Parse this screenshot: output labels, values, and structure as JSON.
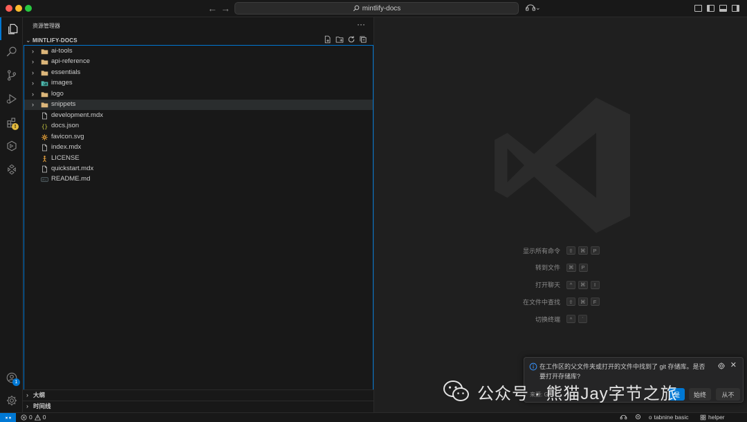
{
  "window": {
    "command_center": "mintlify-docs"
  },
  "activity_bar": {
    "accounts_badge": "1"
  },
  "explorer": {
    "title": "资源管理器",
    "more": "···",
    "folder_name": "MINTLIFY-DOCS",
    "items": [
      {
        "label": "ai-tools",
        "type": "folder"
      },
      {
        "label": "api-reference",
        "type": "folder"
      },
      {
        "label": "essentials",
        "type": "folder"
      },
      {
        "label": "images",
        "type": "folder-images"
      },
      {
        "label": "logo",
        "type": "folder"
      },
      {
        "label": "snippets",
        "type": "folder"
      },
      {
        "label": "development.mdx",
        "type": "file"
      },
      {
        "label": "docs.json",
        "type": "json"
      },
      {
        "label": "favicon.svg",
        "type": "svg"
      },
      {
        "label": "index.mdx",
        "type": "file"
      },
      {
        "label": "LICENSE",
        "type": "license"
      },
      {
        "label": "quickstart.mdx",
        "type": "file"
      },
      {
        "label": "README.md",
        "type": "markdown"
      }
    ],
    "selected_index": 5,
    "outline_label": "大纲",
    "timeline_label": "时间线"
  },
  "editor": {
    "shortcuts": [
      {
        "label": "显示所有命令",
        "keys": [
          "⇧",
          "⌘",
          "P"
        ]
      },
      {
        "label": "转到文件",
        "keys": [
          "⌘",
          "P"
        ]
      },
      {
        "label": "打开聊天",
        "keys": [
          "^",
          "⌘",
          "I"
        ]
      },
      {
        "label": "在文件中查找",
        "keys": [
          "⇧",
          "⌘",
          "F"
        ]
      },
      {
        "label": "切换终端",
        "keys": [
          "^",
          "`"
        ]
      }
    ]
  },
  "notification": {
    "message": "在工作区的父文件夹或打开的文件中找到了 git 存储库。是否要打开存储库?",
    "source": "来源: Git",
    "buttons": {
      "primary": "是",
      "secondary": "始终",
      "never": "从不"
    }
  },
  "watermark": {
    "text": "公众号 · 熊猫Jay字节之旅"
  },
  "status_bar": {
    "errors": "0",
    "warnings": "0",
    "tabnine": "tabnine basic",
    "helper": "helper"
  },
  "colors": {
    "accent": "#0078d4",
    "folder": "#dcb67a",
    "background": "#1f1f1f",
    "sidebar": "#181818"
  }
}
